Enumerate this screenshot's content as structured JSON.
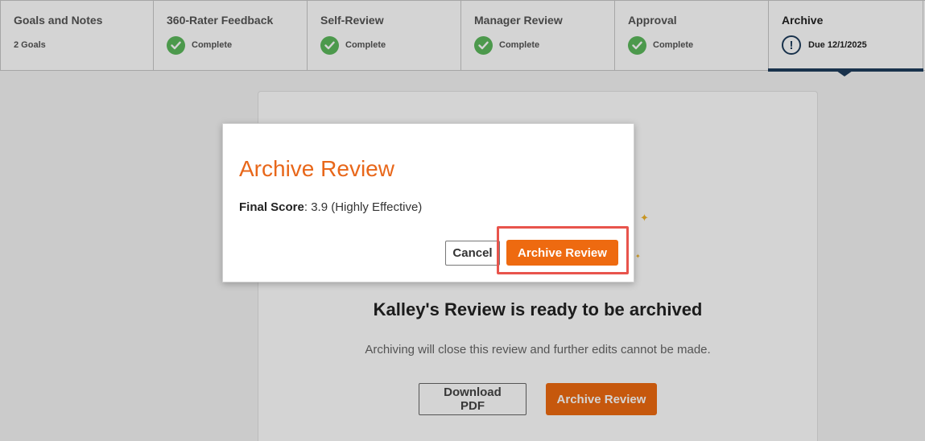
{
  "stepper": {
    "steps": [
      {
        "title": "Goals and Notes",
        "status": "2 Goals",
        "state": "info"
      },
      {
        "title": "360-Rater Feedback",
        "status": "Complete",
        "state": "complete"
      },
      {
        "title": "Self-Review",
        "status": "Complete",
        "state": "complete"
      },
      {
        "title": "Manager Review",
        "status": "Complete",
        "state": "complete"
      },
      {
        "title": "Approval",
        "status": "Complete",
        "state": "complete"
      },
      {
        "title": "Archive",
        "status": "Due 12/1/2025",
        "state": "due",
        "active": true
      }
    ],
    "icons": {
      "complete": "check-circle-icon",
      "due": "exclamation-circle-icon"
    }
  },
  "card": {
    "title": "Kalley's Review is ready to be archived",
    "description": "Archiving will close this review and further edits cannot be made.",
    "download_label": "Download PDF",
    "archive_label": "Archive Review"
  },
  "modal": {
    "title": "Archive Review",
    "score_label": "Final Score",
    "score_value": ": 3.9 (Highly Effective)",
    "cancel_label": "Cancel",
    "confirm_label": "Archive Review"
  },
  "colors": {
    "accent_orange": "#ee6a10",
    "complete_green": "#5cb85c",
    "active_navy": "#1f3d5c",
    "highlight_red": "#e8544c"
  }
}
